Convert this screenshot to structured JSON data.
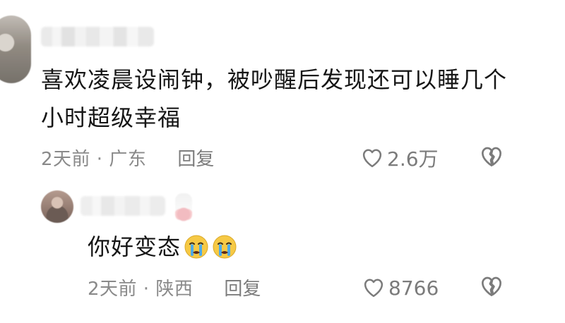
{
  "comment": {
    "text": "喜欢凌晨设闹钟，被吵醒后发现还可以睡几个小时超级幸福",
    "time_location": "2天前 · 广东",
    "reply_label": "回复",
    "likes": "2.6万"
  },
  "reply": {
    "text": "你好变态",
    "time_location": "2天前 · 陕西",
    "reply_label": "回复",
    "likes": "8766"
  },
  "icons": {
    "like": "heart-outline-icon",
    "dislike": "broken-heart-icon",
    "emoji": "crying-face-emoji"
  },
  "colors": {
    "primary_text": "#161616",
    "secondary_text": "#8a8a8a",
    "icon_gray": "#7b7b7b",
    "emoji_yellow": "#f6c945",
    "emoji_tear": "#43a9f2"
  }
}
